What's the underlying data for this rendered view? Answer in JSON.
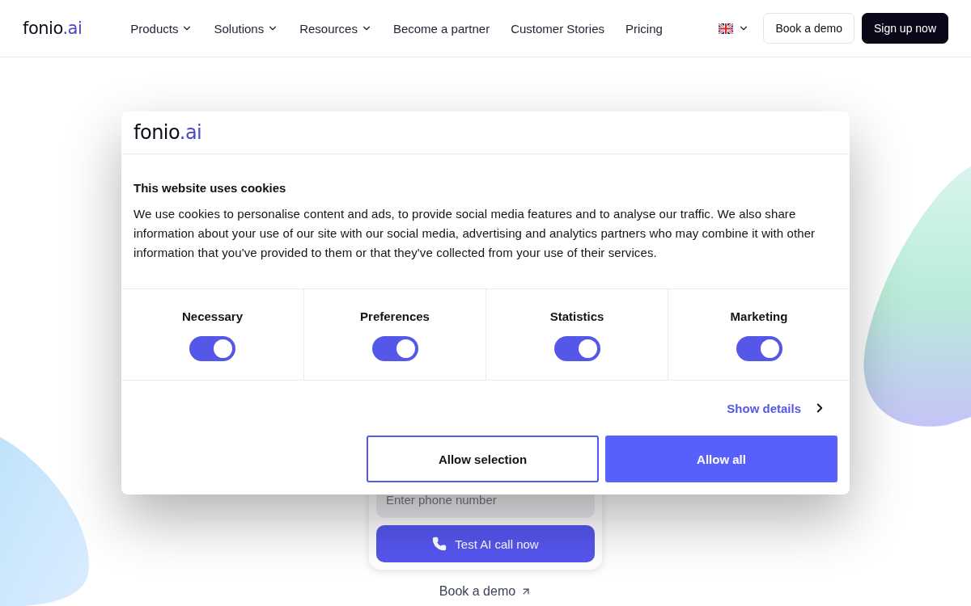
{
  "header": {
    "logo": {
      "main": "fonio",
      "suffix": ".ai"
    },
    "nav": [
      {
        "label": "Products",
        "dropdown": true
      },
      {
        "label": "Solutions",
        "dropdown": true
      },
      {
        "label": "Resources",
        "dropdown": true
      },
      {
        "label": "Become a partner",
        "dropdown": false
      },
      {
        "label": "Customer Stories",
        "dropdown": false
      },
      {
        "label": "Pricing",
        "dropdown": false
      }
    ],
    "buttons": [
      {
        "label": "Book a demo",
        "kind": "outline"
      },
      {
        "label": "Sign up now",
        "kind": "dark"
      }
    ]
  },
  "background": {
    "phone_field": {
      "placeholder": "Enter phone number"
    },
    "call_button": "Test AI call now",
    "demo_link": "Book a demo"
  },
  "cookie_dialog": {
    "logo": {
      "main": "fonio",
      "suffix": ".ai"
    },
    "title": "This website uses cookies",
    "text": "We use cookies to personalise content and ads, to provide social media features and to analyse our traffic. We also share information about your use of our site with our social media, advertising and analytics partners who may combine it with other information that you've provided to them or that they've collected from your use of their services.",
    "categories": [
      {
        "label": "Necessary",
        "on": true
      },
      {
        "label": "Preferences",
        "on": true
      },
      {
        "label": "Statistics",
        "on": true
      },
      {
        "label": "Marketing",
        "on": true
      }
    ],
    "details_link": "Show details",
    "buttons": [
      {
        "label": "Allow selection",
        "kind": "outline"
      },
      {
        "label": "Allow all",
        "kind": "primary"
      }
    ]
  }
}
